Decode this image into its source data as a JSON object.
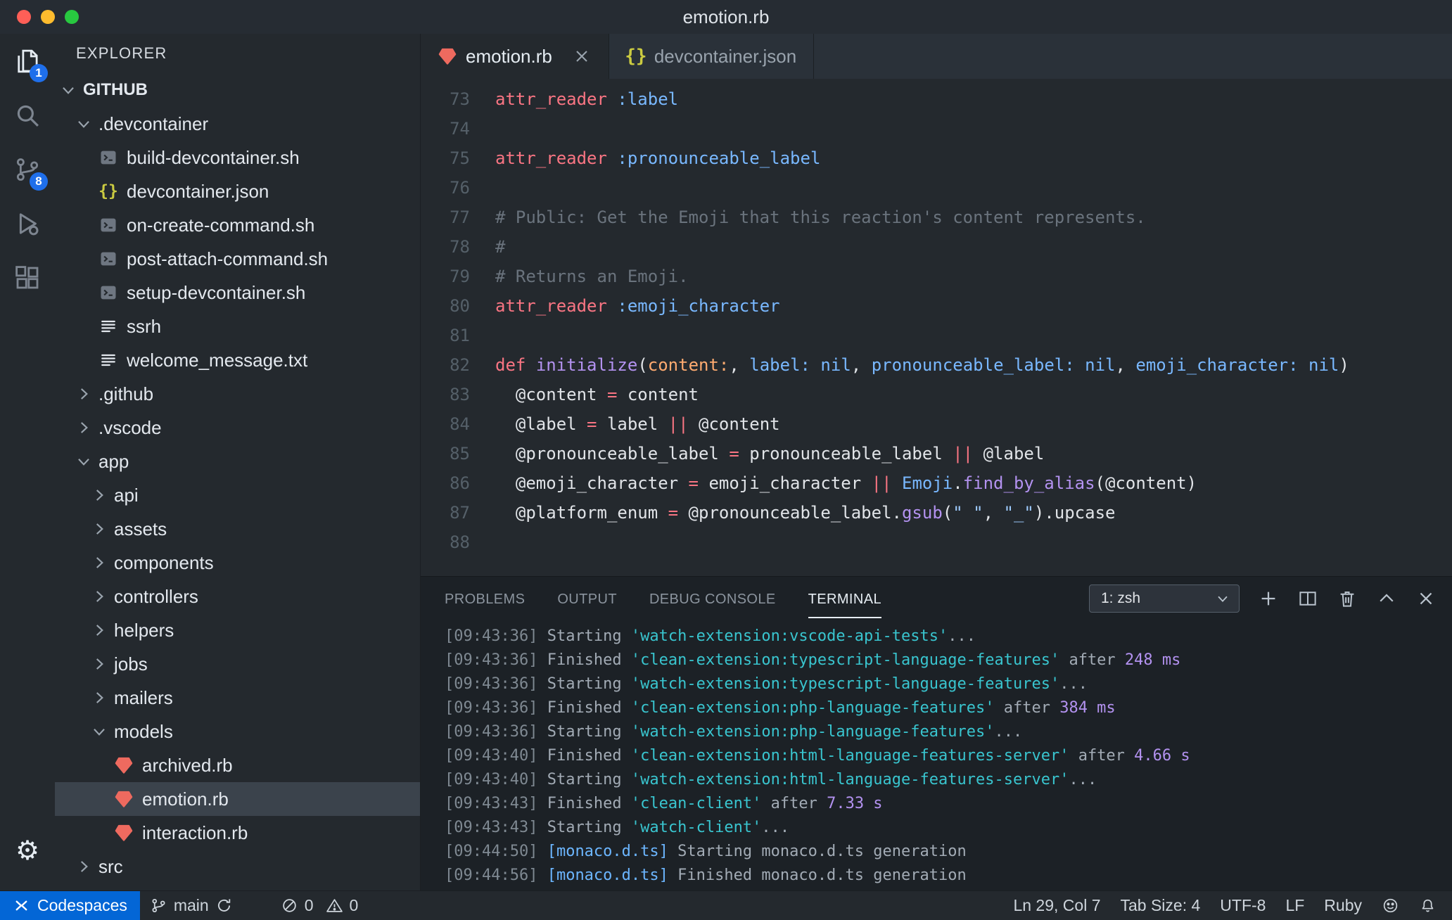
{
  "colors": {
    "codespaces_blue": "#0366d6",
    "badge_blue": "#1f6feb",
    "ruby_red": "#ee6a5f",
    "json_yellow": "#cbcb41",
    "keyword_red": "#f97583",
    "symbol_blue": "#79b8ff",
    "function_purple": "#b392f0",
    "string_blue": "#9ecbff",
    "comment_gray": "#6a737d",
    "terminal_cyan": "#39c5cf",
    "duration_purple": "#b392f0"
  },
  "window": {
    "title": "emotion.rb"
  },
  "activity_bar": {
    "items": [
      {
        "name": "explorer",
        "icon": "files-icon",
        "badge": "1",
        "active": true
      },
      {
        "name": "search",
        "icon": "search-icon"
      },
      {
        "name": "source-control",
        "icon": "source-control-icon",
        "badge": "8"
      },
      {
        "name": "run-debug",
        "icon": "run-debug-icon"
      },
      {
        "name": "extensions",
        "icon": "extensions-icon"
      }
    ],
    "bottom_items": [
      {
        "name": "settings",
        "icon": "gear-icon"
      }
    ]
  },
  "explorer": {
    "title": "EXPLORER",
    "tree": [
      {
        "label": "GITHUB",
        "level": 0,
        "type": "root",
        "state": "expanded"
      },
      {
        "label": ".devcontainer",
        "level": 1,
        "type": "folder",
        "state": "expanded"
      },
      {
        "label": "build-devcontainer.sh",
        "level": 2,
        "type": "file",
        "icon": "shell-icon"
      },
      {
        "label": "devcontainer.json",
        "level": 2,
        "type": "file",
        "icon": "json-icon"
      },
      {
        "label": "on-create-command.sh",
        "level": 2,
        "type": "file",
        "icon": "shell-icon"
      },
      {
        "label": "post-attach-command.sh",
        "level": 2,
        "type": "file",
        "icon": "shell-icon"
      },
      {
        "label": "setup-devcontainer.sh",
        "level": 2,
        "type": "file",
        "icon": "shell-icon"
      },
      {
        "label": "ssrh",
        "level": 2,
        "type": "file",
        "icon": "text-icon"
      },
      {
        "label": "welcome_message.txt",
        "level": 2,
        "type": "file",
        "icon": "text-icon"
      },
      {
        "label": ".github",
        "level": 1,
        "type": "folder",
        "state": "collapsed"
      },
      {
        "label": ".vscode",
        "level": 1,
        "type": "folder",
        "state": "collapsed"
      },
      {
        "label": "app",
        "level": 1,
        "type": "folder",
        "state": "expanded"
      },
      {
        "label": "api",
        "level": 2,
        "type": "folder",
        "state": "collapsed"
      },
      {
        "label": "assets",
        "level": 2,
        "type": "folder",
        "state": "collapsed"
      },
      {
        "label": "components",
        "level": 2,
        "type": "folder",
        "state": "collapsed"
      },
      {
        "label": "controllers",
        "level": 2,
        "type": "folder",
        "state": "collapsed"
      },
      {
        "label": "helpers",
        "level": 2,
        "type": "folder",
        "state": "collapsed"
      },
      {
        "label": "jobs",
        "level": 2,
        "type": "folder",
        "state": "collapsed"
      },
      {
        "label": "mailers",
        "level": 2,
        "type": "folder",
        "state": "collapsed"
      },
      {
        "label": "models",
        "level": 2,
        "type": "folder",
        "state": "expanded"
      },
      {
        "label": "archived.rb",
        "level": 3,
        "type": "file",
        "icon": "ruby-icon"
      },
      {
        "label": "emotion.rb",
        "level": 3,
        "type": "file",
        "icon": "ruby-icon",
        "selected": true
      },
      {
        "label": "interaction.rb",
        "level": 3,
        "type": "file",
        "icon": "ruby-icon"
      },
      {
        "label": "src",
        "level": 1,
        "type": "folder",
        "state": "collapsed"
      }
    ]
  },
  "editor_tabs": [
    {
      "label": "emotion.rb",
      "icon": "ruby-icon",
      "active": true,
      "closeable": true
    },
    {
      "label": "devcontainer.json",
      "icon": "json-icon",
      "active": false
    }
  ],
  "editor": {
    "lines": [
      {
        "n": 73,
        "tokens": [
          {
            "t": "attr_reader",
            "c": "k"
          },
          {
            "t": " "
          },
          {
            "t": ":label",
            "c": "sym"
          }
        ]
      },
      {
        "n": 74,
        "tokens": []
      },
      {
        "n": 75,
        "tokens": [
          {
            "t": "attr_reader",
            "c": "k"
          },
          {
            "t": " "
          },
          {
            "t": ":pronounceable_label",
            "c": "sym"
          }
        ]
      },
      {
        "n": 76,
        "tokens": []
      },
      {
        "n": 77,
        "tokens": [
          {
            "t": "# Public: Get the Emoji that this reaction's content represents.",
            "c": "cm"
          }
        ]
      },
      {
        "n": 78,
        "tokens": [
          {
            "t": "#",
            "c": "cm"
          }
        ]
      },
      {
        "n": 79,
        "tokens": [
          {
            "t": "# Returns an Emoji.",
            "c": "cm"
          }
        ]
      },
      {
        "n": 80,
        "tokens": [
          {
            "t": "attr_reader",
            "c": "k"
          },
          {
            "t": " "
          },
          {
            "t": ":emoji_character",
            "c": "sym"
          }
        ]
      },
      {
        "n": 81,
        "tokens": []
      },
      {
        "n": 82,
        "tokens": [
          {
            "t": "def",
            "c": "k"
          },
          {
            "t": " "
          },
          {
            "t": "initialize",
            "c": "fn"
          },
          {
            "t": "("
          },
          {
            "t": "content:",
            "c": "or"
          },
          {
            "t": ", "
          },
          {
            "t": "label:",
            "c": "sym"
          },
          {
            "t": " "
          },
          {
            "t": "nil",
            "c": "sym"
          },
          {
            "t": ", "
          },
          {
            "t": "pronounceable_label:",
            "c": "sym"
          },
          {
            "t": " "
          },
          {
            "t": "nil",
            "c": "sym"
          },
          {
            "t": ", "
          },
          {
            "t": "emoji_character:",
            "c": "sym"
          },
          {
            "t": " "
          },
          {
            "t": "nil",
            "c": "sym"
          },
          {
            "t": ")"
          }
        ]
      },
      {
        "n": 83,
        "tokens": [
          {
            "t": "  @content "
          },
          {
            "t": "=",
            "c": "k"
          },
          {
            "t": " content"
          }
        ]
      },
      {
        "n": 84,
        "tokens": [
          {
            "t": "  @label "
          },
          {
            "t": "=",
            "c": "k"
          },
          {
            "t": " label "
          },
          {
            "t": "||",
            "c": "k"
          },
          {
            "t": " @content"
          }
        ]
      },
      {
        "n": 85,
        "tokens": [
          {
            "t": "  @pronounceable_label "
          },
          {
            "t": "=",
            "c": "k"
          },
          {
            "t": " pronounceable_label "
          },
          {
            "t": "||",
            "c": "k"
          },
          {
            "t": " @label"
          }
        ]
      },
      {
        "n": 86,
        "tokens": [
          {
            "t": "  @emoji_character "
          },
          {
            "t": "=",
            "c": "k"
          },
          {
            "t": " emoji_character "
          },
          {
            "t": "||",
            "c": "k"
          },
          {
            "t": " "
          },
          {
            "t": "Emoji",
            "c": "sym"
          },
          {
            "t": "."
          },
          {
            "t": "find_by_alias",
            "c": "fn"
          },
          {
            "t": "(@content)"
          }
        ]
      },
      {
        "n": 87,
        "tokens": [
          {
            "t": "  @platform_enum "
          },
          {
            "t": "=",
            "c": "k"
          },
          {
            "t": " @pronounceable_label."
          },
          {
            "t": "gsub",
            "c": "fn"
          },
          {
            "t": "("
          },
          {
            "t": "\" \"",
            "c": "str"
          },
          {
            "t": ", "
          },
          {
            "t": "\"_\"",
            "c": "str"
          },
          {
            "t": ")."
          },
          {
            "t": "upcase"
          }
        ]
      },
      {
        "n": 88,
        "tokens": []
      }
    ]
  },
  "panel": {
    "tabs": [
      {
        "label": "PROBLEMS"
      },
      {
        "label": "OUTPUT"
      },
      {
        "label": "DEBUG CONSOLE"
      },
      {
        "label": "TERMINAL",
        "active": true
      }
    ],
    "shell_select": "1: zsh",
    "terminal_lines": [
      {
        "tokens": [
          {
            "t": "[09:43:36] ",
            "c": "dim"
          },
          {
            "t": "Starting "
          },
          {
            "t": "'watch-extension:vscode-api-tests'",
            "c": "cy"
          },
          {
            "t": "..."
          }
        ]
      },
      {
        "tokens": [
          {
            "t": "[09:43:36] ",
            "c": "dim"
          },
          {
            "t": "Finished "
          },
          {
            "t": "'clean-extension:typescript-language-features'",
            "c": "cy"
          },
          {
            "t": " after "
          },
          {
            "t": "248 ms",
            "c": "mg"
          }
        ]
      },
      {
        "tokens": [
          {
            "t": "[09:43:36] ",
            "c": "dim"
          },
          {
            "t": "Starting "
          },
          {
            "t": "'watch-extension:typescript-language-features'",
            "c": "cy"
          },
          {
            "t": "..."
          }
        ]
      },
      {
        "tokens": [
          {
            "t": "[09:43:36] ",
            "c": "dim"
          },
          {
            "t": "Finished "
          },
          {
            "t": "'clean-extension:php-language-features'",
            "c": "cy"
          },
          {
            "t": " after "
          },
          {
            "t": "384 ms",
            "c": "mg"
          }
        ]
      },
      {
        "tokens": [
          {
            "t": "[09:43:36] ",
            "c": "dim"
          },
          {
            "t": "Starting "
          },
          {
            "t": "'watch-extension:php-language-features'",
            "c": "cy"
          },
          {
            "t": "..."
          }
        ]
      },
      {
        "tokens": [
          {
            "t": "[09:43:40] ",
            "c": "dim"
          },
          {
            "t": "Finished "
          },
          {
            "t": "'clean-extension:html-language-features-server'",
            "c": "cy"
          },
          {
            "t": " after "
          },
          {
            "t": "4.66 s",
            "c": "mg"
          }
        ]
      },
      {
        "tokens": [
          {
            "t": "[09:43:40] ",
            "c": "dim"
          },
          {
            "t": "Starting "
          },
          {
            "t": "'watch-extension:html-language-features-server'",
            "c": "cy"
          },
          {
            "t": "..."
          }
        ]
      },
      {
        "tokens": [
          {
            "t": "[09:43:43] ",
            "c": "dim"
          },
          {
            "t": "Finished "
          },
          {
            "t": "'clean-client'",
            "c": "cy"
          },
          {
            "t": " after "
          },
          {
            "t": "7.33 s",
            "c": "mg"
          }
        ]
      },
      {
        "tokens": [
          {
            "t": "[09:43:43] ",
            "c": "dim"
          },
          {
            "t": "Starting "
          },
          {
            "t": "'watch-client'",
            "c": "cy"
          },
          {
            "t": "..."
          }
        ]
      },
      {
        "tokens": [
          {
            "t": "[09:44:50] ",
            "c": "dim"
          },
          {
            "t": "[monaco.d.ts]",
            "c": "bl"
          },
          {
            "t": " Starting monaco.d.ts generation"
          }
        ]
      },
      {
        "tokens": [
          {
            "t": "[09:44:56] ",
            "c": "dim"
          },
          {
            "t": "[monaco.d.ts]",
            "c": "bl"
          },
          {
            "t": " Finished monaco.d.ts generation"
          }
        ]
      }
    ]
  },
  "status_bar": {
    "codespaces": "Codespaces",
    "branch": "main",
    "errors": "0",
    "warnings": "0",
    "line_col": "Ln 29, Col 7",
    "tab_size": "Tab Size: 4",
    "encoding": "UTF-8",
    "eol": "LF",
    "language": "Ruby"
  }
}
